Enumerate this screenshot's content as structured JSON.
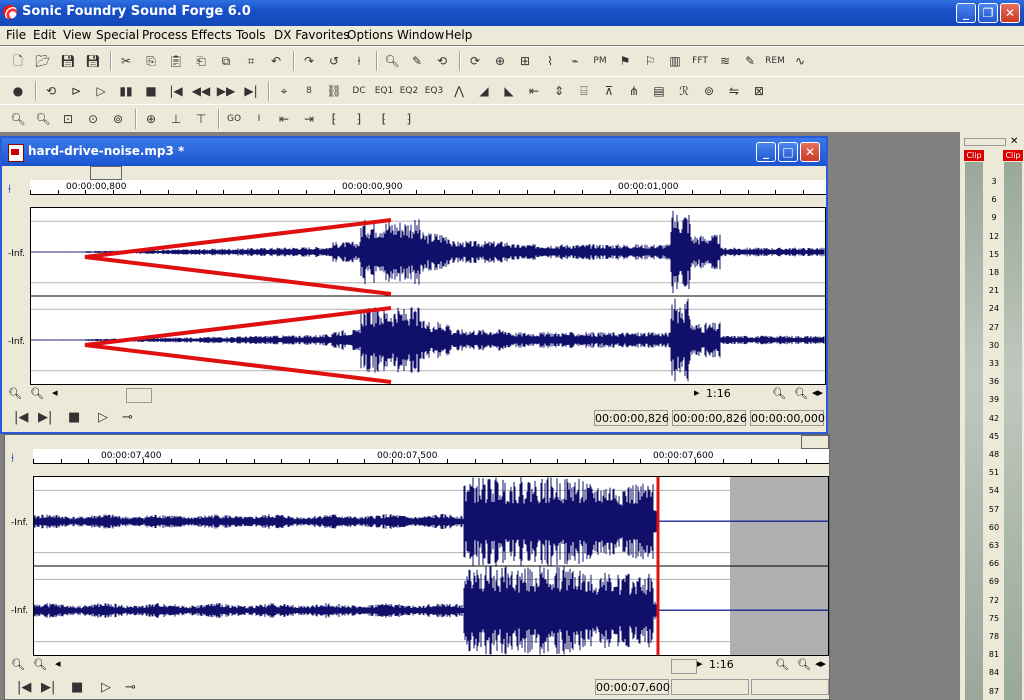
{
  "app": {
    "title": "Sonic Foundry Sound Forge 6.0"
  },
  "menu": [
    "File",
    "Edit",
    "View",
    "Special",
    "Process",
    "Effects",
    "Tools",
    "DX Favorites",
    "Options",
    "Window",
    "Help"
  ],
  "toolbar_row1": [
    "new",
    "open",
    "save",
    "save-as",
    "cut",
    "copy",
    "paste",
    "paste-mix",
    "crossfade",
    "trim",
    "undo",
    "redo",
    "repeat",
    "edit-tool",
    "magnify-tool",
    "pencil-tool",
    "loop",
    "loop2",
    "marker",
    "region",
    "envelope",
    "scrub",
    "PM",
    "flag1",
    "flag2",
    "bars",
    "FFT",
    "noise",
    "pencil",
    "REM",
    "sine"
  ],
  "toolbar_row2": [
    "record",
    "loop-play",
    "play-all",
    "play",
    "pause",
    "stop",
    "go-start",
    "rewind",
    "fast-forward",
    "go-end",
    "snap",
    "8",
    "link",
    "DC",
    "EQ1",
    "EQ2",
    "EQ3",
    "env",
    "fade-in",
    "fade-out",
    "normalize",
    "pan",
    "compress",
    "amp",
    "reverb",
    "graph",
    "stretch",
    "pitch",
    "invert",
    "mute"
  ],
  "toolbar_row3": [
    "zoom-in",
    "zoom-out",
    "zoom-sel",
    "zoom-1",
    "zoom-all",
    "marker",
    "in",
    "out",
    "GO",
    "I",
    "mark-in",
    "mark-out",
    "loop-a",
    "loop-b",
    "loop-c",
    "loop-d"
  ],
  "window1": {
    "title": "hard-drive-noise.mp3 *",
    "ruler": [
      "00:00:00,800",
      "00:00:00,900",
      "00:00:01,000"
    ],
    "channel_labels": [
      "-Inf.",
      "-Inf."
    ],
    "zoom": "1:16",
    "pos1": "00:00:00,826",
    "pos2": "00:00:00,826",
    "pos3": "00:00:00,000"
  },
  "window2": {
    "ruler": [
      "00:00:07,400",
      "00:00:07,500",
      "00:00:07,600"
    ],
    "channel_labels": [
      "-Inf.",
      "-Inf."
    ],
    "zoom": "1:16",
    "pos1": "00:00:07,600"
  },
  "meter": {
    "clip_left": "Clip",
    "clip_right": "Clip",
    "scale": [
      "3",
      "6",
      "9",
      "12",
      "15",
      "18",
      "21",
      "24",
      "27",
      "30",
      "33",
      "36",
      "39",
      "42",
      "45",
      "48",
      "51",
      "54",
      "57",
      "60",
      "63",
      "66",
      "69",
      "72",
      "75",
      "78",
      "81",
      "84",
      "87"
    ]
  }
}
